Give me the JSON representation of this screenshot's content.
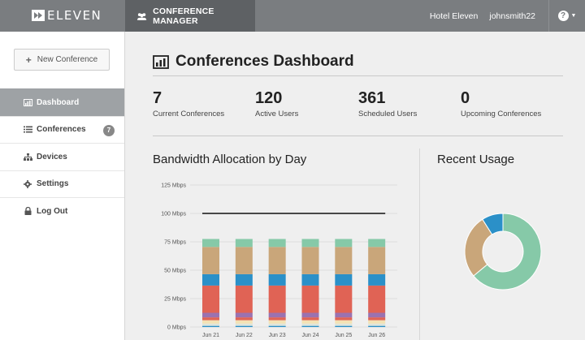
{
  "brand": {
    "logo_text": "ELEVEN"
  },
  "topbar": {
    "module_label": "CONFERENCE MANAGER",
    "hotel": "Hotel Eleven",
    "user": "johnsmith22",
    "help_label": "?"
  },
  "sidebar": {
    "new_button": "New Conference",
    "items": [
      {
        "label": "Dashboard",
        "icon": "bar-chart-icon",
        "active": true
      },
      {
        "label": "Conferences",
        "icon": "list-icon",
        "badge": "7"
      },
      {
        "label": "Devices",
        "icon": "sitemap-icon"
      },
      {
        "label": "Settings",
        "icon": "gear-icon"
      },
      {
        "label": "Log Out",
        "icon": "lock-icon"
      }
    ]
  },
  "page": {
    "title": "Conferences Dashboard"
  },
  "stats": [
    {
      "value": "7",
      "label": "Current Conferences"
    },
    {
      "value": "120",
      "label": "Active Users"
    },
    {
      "value": "361",
      "label": "Scheduled Users"
    },
    {
      "value": "0",
      "label": "Upcoming Conferences"
    }
  ],
  "bandwidth": {
    "title": "Bandwidth Allocation by Day"
  },
  "usage": {
    "title": "Recent Usage"
  },
  "colors": {
    "topbar": "#7a7d80",
    "active_nav": "#9ea2a5",
    "seg_blue": "#2b90c8",
    "seg_orange": "#dde4dc",
    "seg_red": "#e06355",
    "seg_purple": "#9b72b0",
    "seg_tan": "#c9a67a",
    "seg_green": "#86c9a8",
    "seg_cream": "#f3e2b4"
  },
  "chart_data": [
    {
      "type": "bar",
      "title": "Bandwidth Allocation by Day",
      "categories": [
        "Jun 21",
        "Jun 22",
        "Jun 23",
        "Jun 24",
        "Jun 25",
        "Jun 26"
      ],
      "yticks": [
        "0 Mbps",
        "25 Mbps",
        "50 Mbps",
        "75 Mbps",
        "100 Mbps",
        "125 Mbps"
      ],
      "ylim": [
        0,
        125
      ],
      "stacked": true,
      "series": [
        {
          "values": [
            1,
            1,
            1,
            1,
            1,
            1
          ],
          "color": "#2b90c8"
        },
        {
          "values": [
            2,
            2,
            2,
            2,
            2,
            2
          ],
          "color": "#dde4dc"
        },
        {
          "values": [
            3,
            3,
            3,
            3,
            3,
            3
          ],
          "color": "#f3e2b4"
        },
        {
          "values": [
            2.5,
            2.5,
            2.5,
            2.5,
            2.5,
            2.5
          ],
          "color": "#e06355"
        },
        {
          "values": [
            4,
            4,
            4,
            4,
            4,
            4
          ],
          "color": "#9b72b0"
        },
        {
          "values": [
            24,
            24,
            24,
            24,
            24,
            24
          ],
          "color": "#e06355"
        },
        {
          "values": [
            10,
            10,
            10,
            10,
            10,
            10
          ],
          "color": "#2b90c8"
        },
        {
          "values": [
            24,
            24,
            24,
            24,
            24,
            24
          ],
          "color": "#c9a67a"
        },
        {
          "values": [
            7,
            7,
            7,
            7,
            7,
            7
          ],
          "color": "#86c9a8"
        }
      ],
      "reference_line": 100,
      "grid": true
    },
    {
      "type": "pie",
      "title": "Recent Usage",
      "donut": true,
      "slices": [
        {
          "value": 64,
          "color": "#86c9a8"
        },
        {
          "value": 27,
          "color": "#c9a67a"
        },
        {
          "value": 9,
          "color": "#2b90c8"
        }
      ]
    }
  ]
}
